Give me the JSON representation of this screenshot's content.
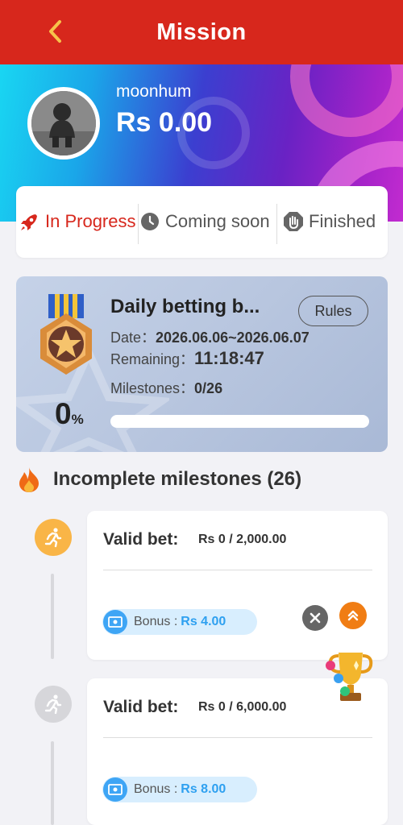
{
  "header": {
    "title": "Mission",
    "back_icon": "chevron-left-icon"
  },
  "profile": {
    "username": "moonhum",
    "balance": "Rs 0.00"
  },
  "tabs": [
    {
      "label": "In Progress",
      "icon": "rocket-icon",
      "active": true
    },
    {
      "label": "Coming soon",
      "icon": "clock-icon",
      "active": false
    },
    {
      "label": "Finished",
      "icon": "hand-stop-icon",
      "active": false
    }
  ],
  "mission": {
    "title": "Daily betting b...",
    "rules_label": "Rules",
    "date_label": "Date：",
    "date_value": "2026.06.06~2026.06.07",
    "remaining_label": "Remaining：",
    "remaining_value": "11:18:47",
    "milestones_label": "Milestones：",
    "milestones_value": "0/26",
    "percent": "0",
    "percent_unit": "%",
    "progress": 0
  },
  "incomplete": {
    "title": "Incomplete milestones (26)",
    "icon": "fire-icon"
  },
  "milestones": [
    {
      "label": "Valid bet:",
      "value": "Rs 0 / 2,000.00",
      "bonus_label": "Bonus : ",
      "bonus_value": "Rs 4.00",
      "status": "active"
    },
    {
      "label": "Valid bet:",
      "value": "Rs 0 / 6,000.00",
      "bonus_label": "Bonus : ",
      "bonus_value": "Rs 8.00",
      "status": "locked"
    }
  ],
  "colors": {
    "brand": "#d7271c",
    "accent_orange": "#f07d14",
    "bonus_blue": "#2ea0f0"
  }
}
